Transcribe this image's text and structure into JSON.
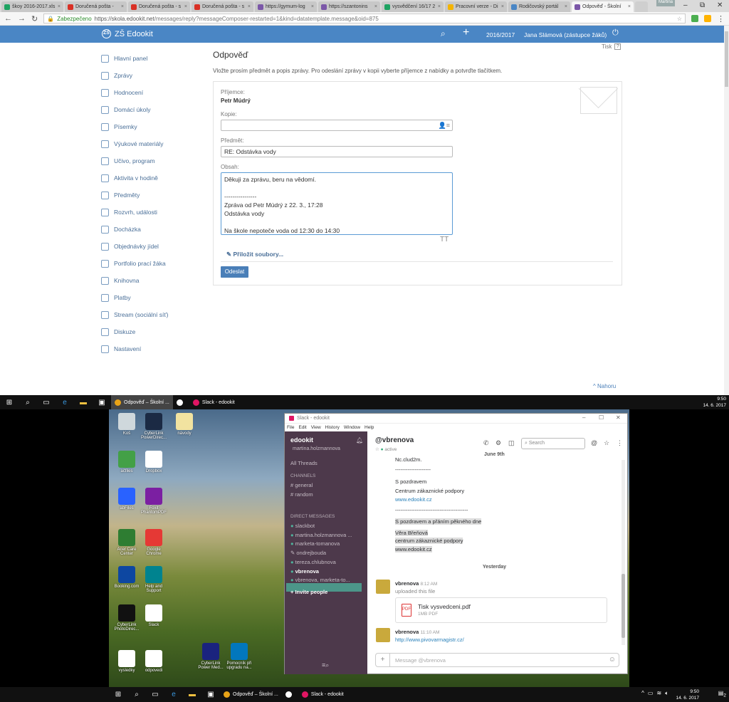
{
  "browser": {
    "tabs": [
      {
        "label": "škoy 2016-2017.xls",
        "color": "#1ea362"
      },
      {
        "label": "Doručená pošta - ",
        "color": "#d93025"
      },
      {
        "label": "Doručená pošta - s",
        "color": "#d93025"
      },
      {
        "label": "Doručená pošta - s",
        "color": "#d93025"
      },
      {
        "label": "https://gymum-log",
        "color": "#7b57a8"
      },
      {
        "label": "https://szantonins",
        "color": "#7b57a8"
      },
      {
        "label": "vysvědčení 16/17 2",
        "color": "#1ea362"
      },
      {
        "label": "Pracovní verze - Di",
        "color": "#f4b400"
      },
      {
        "label": "Rodičovský portál",
        "color": "#4a86c5"
      },
      {
        "label": "Odpověď - Školní",
        "color": "#7b57a8",
        "active": true
      }
    ],
    "win_user": "Martina",
    "secure_label": "Zabezpečeno",
    "url_host": "https://skola.edookit.net",
    "url_path": "/messages/reply?messageComposer-restarted=1&kind=datatemplate.message&oid=875"
  },
  "app": {
    "logo_badge": "ZŠ",
    "logo_text": "ZŠ Edookit",
    "year": "2016/2017",
    "user": "Jana Slámová (zástupce žáků)",
    "print_label": "Tisk",
    "print_help": "?"
  },
  "sidebar": {
    "items": [
      {
        "label": "Hlavní panel"
      },
      {
        "label": "Zprávy"
      },
      {
        "label": "Hodnocení"
      },
      {
        "label": "Domácí úkoly"
      },
      {
        "label": "Písemky"
      },
      {
        "label": "Výukové materiály"
      },
      {
        "label": "Učivo, program"
      },
      {
        "label": "Aktivita v hodině"
      },
      {
        "label": "Předměty"
      },
      {
        "label": "Rozvrh, události"
      },
      {
        "label": "Docházka"
      },
      {
        "label": "Objednávky jídel"
      },
      {
        "label": "Portfolio prací žáka"
      },
      {
        "label": "Knihovna"
      },
      {
        "label": "Platby"
      },
      {
        "label": "Stream (sociální síť)"
      },
      {
        "label": "Diskuze"
      },
      {
        "label": "Nastavení"
      }
    ]
  },
  "page": {
    "title": "Odpověď",
    "description": "Vložte prosím předmět a popis zprávy. Pro odeslání zprávy v kopii vyberte příjemce z nabídky a potvrďte tlačítkem.",
    "recipient_label": "Příjemce:",
    "recipient": "Petr Múdrý",
    "cc_label": "Kopie:",
    "cc_value": "",
    "subject_label": "Předmět:",
    "subject": "RE: Odstávka vody",
    "body_label": "Obsah:",
    "body_lines": [
      "Děkuji za zprávu, beru na vědomí.",
      "",
      "----------------",
      "Zpráva od Petr Múdrý z 22. 3., 17:28",
      "Odstávka vody",
      "",
      "Na škole nepoteče voda od 12:30 do 14:30"
    ],
    "text_size_icon": "TT",
    "attach_label": "Přiložit soubory...",
    "send_label": "Odeslat",
    "top_link": "Nahoru"
  },
  "taskbar_top": {
    "apps": [
      {
        "label": "Odpověď – Školní ...",
        "color": "#e8a317",
        "active": true
      },
      {
        "label": "",
        "color": "#ffffff"
      },
      {
        "label": "Slack - edookit",
        "color": "#e01563"
      }
    ],
    "time": "9:50",
    "date": "14. 6. 2017"
  },
  "desktop": {
    "icons": [
      {
        "label": "Koš",
        "color": "#cfd8dc"
      },
      {
        "label": "CyberLink PowerDirec...",
        "color": "#1b2a44"
      },
      {
        "label": "návody",
        "color": "#f2e3a0"
      },
      {
        "label": "ačfiles",
        "color": "#43a047"
      },
      {
        "label": "Dropbox",
        "color": "#ffffff"
      },
      {
        "label": "abFiles",
        "color": "#2962ff"
      },
      {
        "label": "Foxit PhantomPDF",
        "color": "#7b1fa2"
      },
      {
        "label": "Acer Care Center",
        "color": "#2e7d32"
      },
      {
        "label": "Google Chrome",
        "color": "#e53935"
      },
      {
        "label": "Booking.com",
        "color": "#0d47a1"
      },
      {
        "label": "Help and Support",
        "color": "#00838f"
      },
      {
        "label": "CyberLink PhotoDirec...",
        "color": "#111111"
      },
      {
        "label": "Slack",
        "color": "#ffffff"
      },
      {
        "label": "vysledky",
        "color": "#ffffff"
      },
      {
        "label": "odpovedi",
        "color": "#ffffff"
      },
      {
        "label": "CyberLink Power Med...",
        "color": "#1a237e"
      },
      {
        "label": "Pomocník při upgradu na...",
        "color": "#0277bd"
      }
    ]
  },
  "slack": {
    "window_title": "Slack - edookit",
    "menu": [
      "File",
      "Edit",
      "View",
      "History",
      "Window",
      "Help"
    ],
    "team": "edookit",
    "me": "martina.holzmannova",
    "all_threads": "All Threads",
    "channels_header": "CHANNELS",
    "channels": [
      "# general",
      "# random"
    ],
    "dm_header": "DIRECT MESSAGES",
    "dms": [
      "slackbot",
      "martina.holzmannova ...",
      "marketa-tomanova",
      "ondrejbouda",
      "tereza.chlubnova",
      "vbrenova",
      "vbrenova, marketa-to..."
    ],
    "invite": "+ Invite people",
    "channel": "@vbrenova",
    "status": "active",
    "search_placeholder": "Search",
    "date_top": "June 9th",
    "lines": [
      "Nc.clud2m.",
      "--------------------",
      "S pozdravem",
      "Centrum zákaznické podpory",
      "www.edookit.cz",
      "-----------------------------------------",
      "S pozdravem a přáním pěkného dne",
      "Věra Břeňová",
      "centrum zákaznické podpory",
      "www.edookit.cz"
    ],
    "date_yesterday": "Yesterday",
    "msg1_sender": "vbrenova",
    "msg1_time": "8:12 AM",
    "msg1_text": "uploaded this file",
    "file_name": "Tisk vysvedceni.pdf",
    "file_size": "1MB PDF",
    "file_icon": "PDF",
    "msg2_sender": "vbrenova",
    "msg2_time": "11:10 AM",
    "msg2_link": "http://www.pivovarmagistr.cz/",
    "input_placeholder": "Message @vbrenova"
  },
  "taskbar_bottom": {
    "apps": [
      {
        "label": "Odpověď – Školní ...",
        "color": "#e8a317"
      },
      {
        "label": "",
        "color": "#ffffff"
      },
      {
        "label": "Slack - edookit",
        "color": "#e01563"
      }
    ],
    "time": "9:50",
    "date": "14. 6. 2017",
    "notification_count": "2"
  }
}
